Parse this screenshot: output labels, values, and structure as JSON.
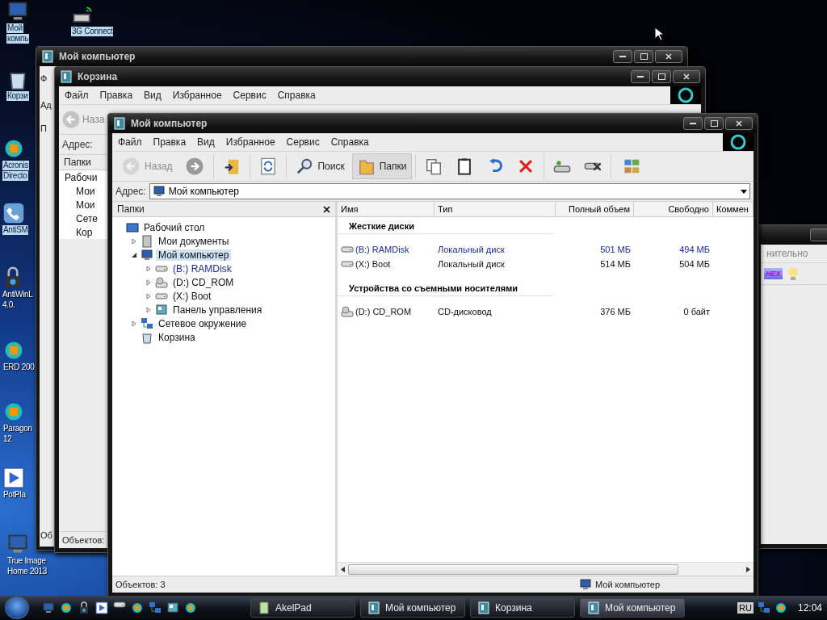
{
  "desktop_icons": [
    {
      "kind": "computer",
      "lines": [
        "Мой",
        "компь"
      ],
      "selected": true
    },
    {
      "kind": "modem",
      "lines": [
        "3G Connect"
      ],
      "selected": true
    },
    {
      "kind": "trash",
      "lines": [
        "Корзи"
      ],
      "selected": true
    },
    {
      "kind": "app",
      "lines": [
        "Acronis",
        "Directo"
      ],
      "selected": true
    },
    {
      "kind": "phone",
      "lines": [
        "AntiSM"
      ],
      "selected": true
    },
    {
      "kind": "lock",
      "lines": [
        "AntiWinL",
        "4.0."
      ],
      "selected": false
    },
    {
      "kind": "app",
      "lines": [
        "ERD 200"
      ],
      "selected": false
    },
    {
      "kind": "app",
      "lines": [
        "Paragon",
        "12"
      ],
      "selected": false
    },
    {
      "kind": "player",
      "lines": [
        "PotPla"
      ],
      "selected": false
    },
    {
      "kind": "computer",
      "lines": [
        "True Image",
        "Home 2013"
      ],
      "selected": false
    }
  ],
  "back_windows": [
    {
      "title": "Мой компьютер",
      "menu_fragment": "Ф",
      "address_fragment": "Ад",
      "pane_fragment": "П",
      "status_fragment": "Об"
    },
    {
      "title": "Корзина",
      "menu": [
        "Файл",
        "Правка",
        "Вид",
        "Избранное",
        "Сервис",
        "Справка"
      ],
      "back_label": "Наза",
      "address_label": "Адрес:",
      "pane_title": "Папки",
      "tree": [
        "Рабочи",
        "Мои",
        "Мои",
        "Сете",
        "Кор"
      ],
      "status": "Объектов:"
    }
  ],
  "side_window": {
    "menu_fragment": "нительно",
    "hex_label": "HEX"
  },
  "window": {
    "title": "Мой компьютер",
    "menu": [
      "Файл",
      "Правка",
      "Вид",
      "Избранное",
      "Сервис",
      "Справка"
    ],
    "toolbar": [
      {
        "kind": "back",
        "label": "Назад",
        "disabled": true,
        "pressed": false
      },
      {
        "kind": "forward",
        "disabled": false,
        "pressed": false
      },
      {
        "kind": "up",
        "disabled": false,
        "pressed": false
      },
      {
        "kind": "sync",
        "disabled": false,
        "pressed": false
      },
      {
        "kind": "search",
        "label": "Поиск",
        "disabled": false,
        "pressed": false
      },
      {
        "kind": "folders",
        "label": "Папки",
        "disabled": false,
        "pressed": true
      },
      {
        "kind": "copy",
        "disabled": false,
        "pressed": false
      },
      {
        "kind": "paste",
        "disabled": false,
        "pressed": false
      },
      {
        "kind": "undo",
        "disabled": false,
        "pressed": false
      },
      {
        "kind": "delete",
        "disabled": false,
        "pressed": false
      },
      {
        "kind": "drive",
        "disabled": false,
        "pressed": false
      },
      {
        "kind": "drive-x",
        "disabled": false,
        "pressed": false
      },
      {
        "kind": "views",
        "disabled": false,
        "pressed": false
      }
    ],
    "address": {
      "label": "Адрес:",
      "value": "Мой компьютер"
    },
    "tree_title": "Папки",
    "tree": [
      {
        "label": "Рабочий стол",
        "kind": "desktop",
        "selected": false,
        "highlighted": false,
        "children": [
          {
            "label": "Мои документы",
            "kind": "docs",
            "expanded": false,
            "selected": false,
            "highlighted": false
          },
          {
            "label": "Мой компьютер",
            "kind": "computer",
            "expanded": true,
            "selected": true,
            "highlighted": false,
            "children": [
              {
                "label": "(B:) RAMDisk",
                "kind": "drive",
                "expanded": false,
                "selected": false,
                "highlighted": true
              },
              {
                "label": "(D:) CD_ROM",
                "kind": "cd",
                "expanded": false,
                "selected": false,
                "highlighted": false
              },
              {
                "label": "(X:) Boot",
                "kind": "drive",
                "expanded": false,
                "selected": false,
                "highlighted": false
              },
              {
                "label": "Панель управления",
                "kind": "panel",
                "expanded": false,
                "selected": false,
                "highlighted": false
              }
            ]
          },
          {
            "label": "Сетевое окружение",
            "kind": "network",
            "expanded": false,
            "selected": false,
            "highlighted": false
          },
          {
            "label": "Корзина",
            "kind": "trash",
            "selected": false,
            "highlighted": false
          }
        ]
      }
    ],
    "columns": [
      "Имя",
      "Тип",
      "Полный объем",
      "Свободно",
      "Коммен"
    ],
    "groups": [
      {
        "title": "Жесткие диски",
        "rows": [
          {
            "kind": "drive",
            "name": "(B:) RAMDisk",
            "type": "Локальный диск",
            "total": "501 МБ",
            "free": "494 МБ",
            "highlighted": true
          },
          {
            "kind": "drive",
            "name": "(X:) Boot",
            "type": "Локальный диск",
            "total": "514 МБ",
            "free": "504 МБ",
            "highlighted": false
          }
        ]
      },
      {
        "title": "Устройства со съемными носителями",
        "rows": [
          {
            "kind": "cd",
            "name": "(D:) CD_ROM",
            "type": "CD-дисковод",
            "total": "376 МБ",
            "free": "0 байт",
            "highlighted": false
          }
        ]
      }
    ],
    "status_bar": {
      "count": "Объектов: 3",
      "location": "Мой компьютер"
    }
  },
  "taskbar": {
    "tasks": [
      {
        "kind": "notepad",
        "label": "AkelPad",
        "selected": false
      },
      {
        "kind": "explorer",
        "label": "Мой компьютер",
        "selected": false
      },
      {
        "kind": "explorer",
        "label": "Корзина",
        "selected": false
      },
      {
        "kind": "explorer",
        "label": "Мой компьютер",
        "selected": true
      }
    ],
    "language": "RU",
    "clock": "12:04"
  }
}
